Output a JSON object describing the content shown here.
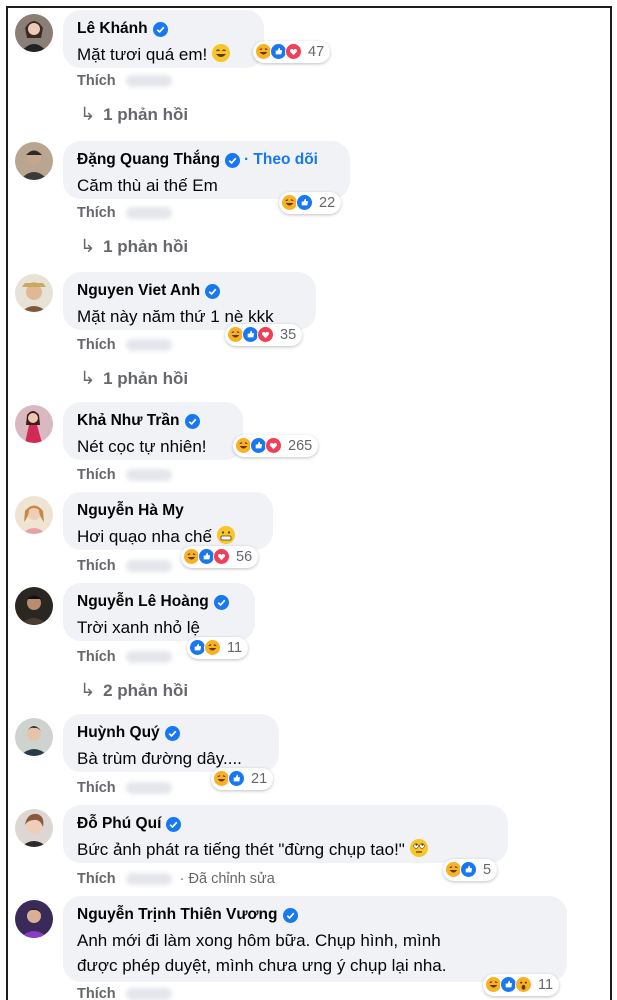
{
  "comments": [
    {
      "name": "Lê Khánh",
      "text": "Mặt tươi quá em!",
      "reactions": "47",
      "like": "Thích",
      "replies": "1 phản hồi"
    },
    {
      "name": "Đặng Quang Thắng",
      "follow": "Theo dõi",
      "text": "Căm thù ai thế Em",
      "reactions": "22",
      "like": "Thích",
      "replies": "1 phản hồi"
    },
    {
      "name": "Nguyen Viet Anh",
      "text": "Mặt này năm thứ 1 nè kkk",
      "reactions": "35",
      "like": "Thích",
      "replies": "1 phản hồi"
    },
    {
      "name": "Khả Như Trần",
      "text": "Nét cọc tự nhiên!",
      "reactions": "265",
      "like": "Thích"
    },
    {
      "name": "Nguyễn Hà My",
      "text": "Hơi quạo nha chế",
      "reactions": "56",
      "like": "Thích"
    },
    {
      "name": "Nguyễn Lê Hoàng",
      "text": "Trời xanh nhỏ lệ",
      "reactions": "11",
      "like": "Thích",
      "replies": "2 phản hồi"
    },
    {
      "name": "Huỳnh Quý",
      "text": "Bà trùm đường dây....",
      "reactions": "21",
      "like": "Thích"
    },
    {
      "name": "Đỗ Phú Quí",
      "text": "Bức ảnh phát ra tiếng thét \"đừng chụp tao!\"",
      "reactions": "5",
      "like": "Thích",
      "edited": "· Đã chỉnh sửa"
    },
    {
      "name": "Nguyễn Trịnh Thiên Vương",
      "text": "Anh mới đi làm xong hôm bữa. Chụp hình, mình được phép duyệt, mình chưa ưng ý chụp lại nha.",
      "reactions": "11",
      "like": "Thích"
    }
  ],
  "colors": {
    "like_blue": "#1877f2",
    "love_red": "#f33e58",
    "haha_yellow": "#f7b125",
    "bubble": "#f0f2f5",
    "meta_gray": "#65676b"
  },
  "icons": [
    "verified-badge-icon",
    "reply-arrow-icon",
    "like-reaction-icon",
    "love-reaction-icon",
    "haha-reaction-icon",
    "wow-reaction-icon"
  ]
}
